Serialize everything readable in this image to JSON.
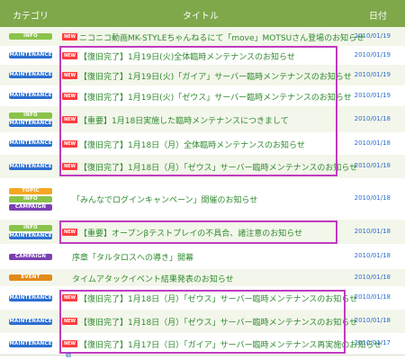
{
  "header": {
    "category": "カテゴリ",
    "title": "タイトル",
    "date": "日付"
  },
  "rows": [
    {
      "badges": [
        "INFO"
      ],
      "new": true,
      "title": "ニコニコ動画MK-STYLEちゃんねるにて「move」MOTSUさん登場のお知らせ",
      "date": "2010/01/19"
    },
    {
      "badges": [
        "MAINTENANCE"
      ],
      "new": true,
      "title": "【復旧完了】1月19日(火)全体臨時メンテナンスのお知らせ",
      "date": "2010/01/19"
    },
    {
      "badges": [
        "MAINTENANCE"
      ],
      "new": true,
      "title": "【復旧完了】1月19日(火)「ガイア」サーバー臨時メンテナンスのお知らせ",
      "date": "2010/01/19"
    },
    {
      "badges": [
        "MAINTENANCE"
      ],
      "new": true,
      "title": "【復旧完了】1月19日(火)「ゼウス」サーバー臨時メンテナンスのお知らせ",
      "date": "2010/01/19"
    },
    {
      "badges": [
        "INFO",
        "MAINTENANCE"
      ],
      "new": true,
      "title": "【重要】1月18日実施した臨時メンテナンスにつきまして",
      "date": "2010/01/18"
    },
    {
      "badges": [
        "MAINTENANCE"
      ],
      "new": true,
      "title": "【復旧完了】1月18日（月）全体臨時メンテナンスのお知らせ",
      "date": "2010/01/18"
    },
    {
      "badges": [
        "MAINTENANCE"
      ],
      "new": true,
      "title": "【復旧完了】1月18日（月）「ゼウス」サーバー臨時メンテナンスのお知らせ",
      "date": "2010/01/18"
    },
    {
      "badges": [
        "TOPIC",
        "INFO",
        "CAMPAIGN"
      ],
      "new": false,
      "title": "「みんなでログインキャンペーン」開催のお知らせ",
      "date": "2010/01/18"
    },
    {
      "badges": [
        "INFO",
        "MAINTENANCE"
      ],
      "new": true,
      "title": "【重要】オープンβテストプレイの不具合、諸注意のお知らせ",
      "date": "2010/01/18"
    },
    {
      "badges": [
        "CAMPAIGN"
      ],
      "new": false,
      "title": "序章「タルタロスへの導き」開幕",
      "date": "2010/01/18"
    },
    {
      "badges": [
        "EVENT"
      ],
      "new": false,
      "title": "タイムアタックイベント結果発表のお知らせ",
      "date": "2010/01/18"
    },
    {
      "badges": [
        "MAINTENANCE"
      ],
      "new": true,
      "title": "【復旧完了】1月18日（月）「ゼウス」サーバー臨時メンテナンスのお知らせ",
      "date": "2010/01/18"
    },
    {
      "badges": [
        "MAINTENANCE"
      ],
      "new": true,
      "title": "【復旧完了】1月18日（月）「ゼウス」サーバー臨時メンテナンスのお知らせ",
      "date": "2010/01/18"
    },
    {
      "badges": [
        "MAINTENANCE"
      ],
      "new": true,
      "title": "【復旧完了】1月17日（日）「ガイア」サーバー臨時メンテナンス再実施のお知らせ",
      "date": "2010/01/17"
    }
  ],
  "new_label": "NEW",
  "colors": {
    "header_bg": "#7ea84a",
    "title_text": "#2f8a2f",
    "date_text": "#2b6ed1",
    "highlight": "#c03bc0",
    "info": "#8bc34a",
    "maintenance": "#2b6ed1",
    "topic": "#f5a623",
    "campaign": "#7b3fb3",
    "event": "#e28a1a",
    "new_badge": "#ff3b3b"
  },
  "icons": {
    "new_marker": "new-badge-icon",
    "footer": "small-link-icon"
  }
}
